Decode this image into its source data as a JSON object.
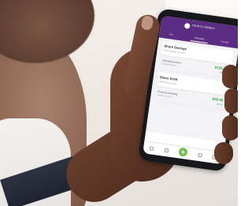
{
  "app": {
    "brand": "YOUR CU MOBILE",
    "tabs": [
      "Join",
      "Accounts",
      "Transfer"
    ]
  },
  "accounts": [
    {
      "group_title": "Share Savings",
      "group_sub": "Primary share account",
      "item_name": "Checking Account",
      "item_sub": "Available balance",
      "amount": "$125.00",
      "available": "$125.00"
    },
    {
      "group_title": "Share Draft",
      "group_sub": "Checking account",
      "item_name": "Personal Checking",
      "item_sub": "Available balance",
      "amount": "$56.00",
      "available": "$56.00"
    }
  ],
  "bottom_nav": [
    "home-icon",
    "transfer-icon",
    "add-icon",
    "deposit-icon",
    "more-icon"
  ],
  "colors": {
    "header": "#5a2d82",
    "amount": "#3aa655",
    "fab": "#6dbf4a"
  }
}
